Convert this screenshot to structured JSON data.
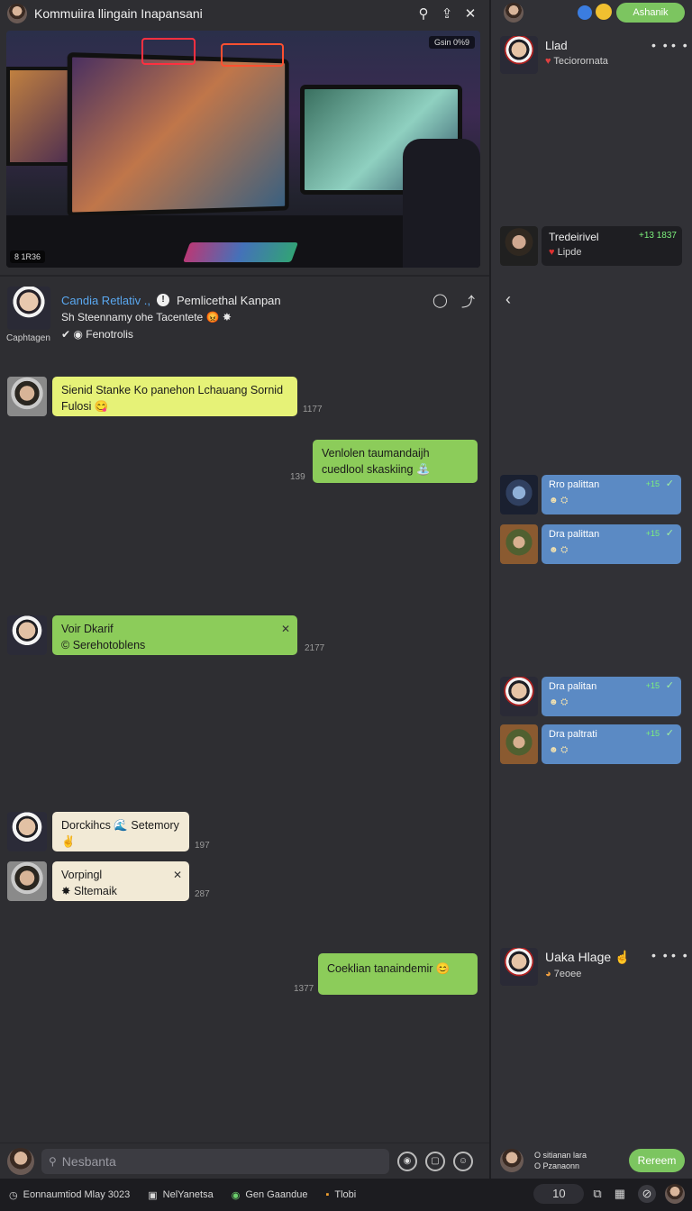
{
  "window": {
    "title": "Kommuiira llingain Inapansani"
  },
  "video": {
    "badge_top_right": "Gsin  0%9",
    "badge_bottom_left": "8 1R36"
  },
  "profile": {
    "name": "Candia Retlativ .,",
    "name_suffix": "Pemlicethal Kanpan",
    "line2": "Sh Steennamy ohe Tacentete",
    "line3": "Fenotrolis",
    "caption": "Caphtagen"
  },
  "messages": [
    {
      "text": "Sienid Stanke Ko panehon Lchauang Sornid Fulosi",
      "time": "1177",
      "style": "yellow"
    },
    {
      "text": "Venlolen taumandaijh cuedlool skaskiing",
      "time": "139",
      "style": "green"
    },
    {
      "text1": "Voir Dkarif",
      "text2": "Serehotoblens",
      "time": "2177",
      "style": "green"
    },
    {
      "text1": "Dorckihcs",
      "text2": "Setemory",
      "time": "197",
      "style": "cream"
    },
    {
      "text1": "Vorpingl",
      "text2": "Sltemaik",
      "time": "287",
      "style": "cream"
    },
    {
      "text": "Coeklian tanaindemir",
      "time": "1377",
      "style": "green"
    }
  ],
  "composer": {
    "placeholder": "Nesbanta"
  },
  "right_panel": {
    "top_button": "Ashanik",
    "card1": {
      "name": "Llad",
      "sub": "Teciorornata"
    },
    "dark_msg": {
      "name": "Tredeirivel",
      "sub": "Lipde",
      "num": "+13 1837"
    },
    "blue_msgs": [
      {
        "name": "Rro palittan",
        "num": "+15"
      },
      {
        "name": "Dra palittan",
        "num": "+15"
      },
      {
        "name": "Dra palitan",
        "num": "+15"
      },
      {
        "name": "Dra paltrati",
        "num": "+15"
      }
    ],
    "card2": {
      "name": "Uaka Hlage",
      "sub": "7eoee"
    },
    "composer_line1": "O  sitianan lara",
    "composer_line2": "O  Pzanaonn",
    "send_button": "Rereem"
  },
  "statusbar": {
    "item1": "Eonnaumtiod Mlay   3023",
    "item2": "NelYanetsa",
    "item3": "Gen Gaandue",
    "item4": "Tlobi",
    "counter": "10"
  },
  "colors": {
    "accent_green": "#7cc560",
    "bubble_yellow": "#e6f277",
    "bubble_green": "#8ccc5a",
    "bubble_blue": "#5b8ac4",
    "link_blue": "#5aa8f0"
  }
}
